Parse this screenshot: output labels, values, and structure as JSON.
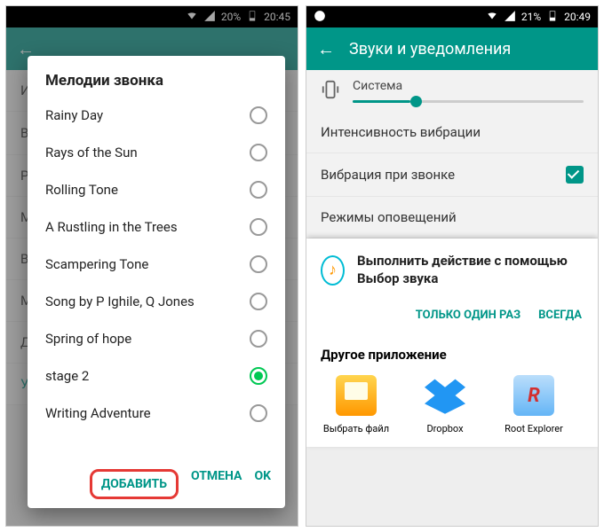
{
  "left": {
    "status": {
      "battery": "20%",
      "time": "20:45"
    },
    "dialog": {
      "title": "Мелодии звонка",
      "items": [
        {
          "label": "Rainy Day",
          "selected": false
        },
        {
          "label": "Rays of the Sun",
          "selected": false
        },
        {
          "label": "Rolling Tone",
          "selected": false
        },
        {
          "label": "A Rustling in the Trees",
          "selected": false
        },
        {
          "label": "Scampering Tone",
          "selected": false
        },
        {
          "label": "Song by P Ighile, Q Jones",
          "selected": false
        },
        {
          "label": "Spring of hope",
          "selected": false
        },
        {
          "label": "stage 2",
          "selected": true
        },
        {
          "label": "Writing Adventure",
          "selected": false
        }
      ],
      "add": "ДОБАВИТЬ",
      "cancel": "ОТМЕНА",
      "ok": "OK"
    },
    "bg_notify": "Уведомление"
  },
  "right": {
    "status": {
      "battery": "21%",
      "time": "20:49"
    },
    "title": "Звуки и уведомления",
    "system_label": "Система",
    "rows": {
      "vib_intensity": "Интенсивность вибрации",
      "vib_on_call": "Вибрация при звонке",
      "notif_modes": "Режимы оповещений"
    },
    "chooser": {
      "title": "Выполнить действие с помощью Выбор звука",
      "once": "ТОЛЬКО ОДИН РАЗ",
      "always": "ВСЕГДА",
      "other_title": "Другое приложение",
      "apps": [
        {
          "name": "Выбрать файл",
          "icon": "file"
        },
        {
          "name": "Dropbox",
          "icon": "dropbox"
        },
        {
          "name": "Root Explorer",
          "icon": "root"
        }
      ]
    }
  }
}
